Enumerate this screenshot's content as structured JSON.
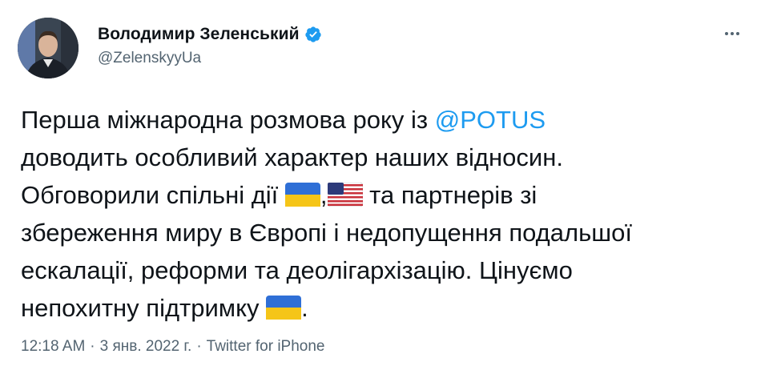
{
  "author": {
    "display_name": "Володимир Зеленський",
    "handle": "@ZelenskyyUa",
    "verified": true,
    "avatar_icon": "user-avatar-photo",
    "verified_icon": "verified-badge-icon"
  },
  "more_icon": "more-options-icon",
  "tweet": {
    "line1_a": "Перша міжнародна розмова року із ",
    "mention": "@POTUS",
    "line2": "доводить особливий характер наших відносин.",
    "line3_a": "Обговорили спільні дії ",
    "line3_sep": ",",
    "line3_b": " та партнерів зі",
    "line4": "збереження миру в Європі і недопущення подальшої",
    "line5": "ескалації, реформи та деолігархізацію. Цінуємо",
    "line6_a": "непохитну підтримку ",
    "line6_b": ".",
    "emoji": [
      "ukraine-flag",
      "usa-flag",
      "ukraine-flag"
    ]
  },
  "meta": {
    "time": "12:18 AM",
    "dot1": "·",
    "date": "3 янв. 2022 г.",
    "dot2": "·",
    "source": "Twitter for iPhone"
  },
  "colors": {
    "link": "#1d9bf0",
    "secondary": "#536471",
    "text": "#0f1419",
    "ua_blue": "#2f6fd6",
    "ua_yellow": "#f5c518"
  }
}
